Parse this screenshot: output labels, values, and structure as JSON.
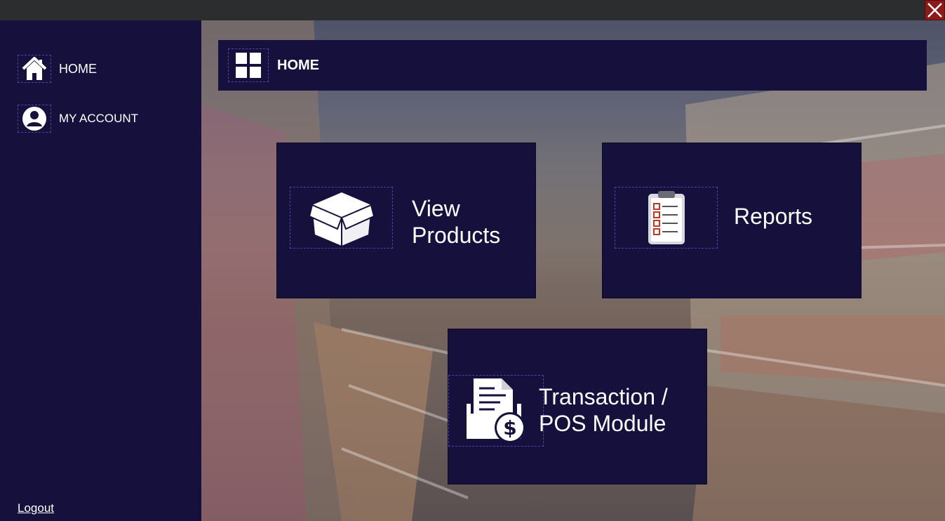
{
  "window": {
    "close_icon": "close-icon",
    "close_color": "#8b1a1a"
  },
  "sidebar": {
    "items": [
      {
        "label": "HOME",
        "icon": "home-icon"
      },
      {
        "label": "MY ACCOUNT",
        "icon": "user-icon"
      }
    ],
    "logout_label": "Logout"
  },
  "header": {
    "title": "HOME",
    "icon": "grid-icon"
  },
  "tiles": [
    {
      "label_line1": "View",
      "label_line2": "Products",
      "icon": "box-icon"
    },
    {
      "label": "Reports",
      "icon": "clipboard-icon"
    },
    {
      "label_line1": "Transaction /",
      "label_line2": "POS Module",
      "icon": "invoice-dollar-icon"
    }
  ],
  "colors": {
    "panel": "#15103c",
    "accent_border": "#4a43a8",
    "titlebar": "#2b2d2f"
  }
}
